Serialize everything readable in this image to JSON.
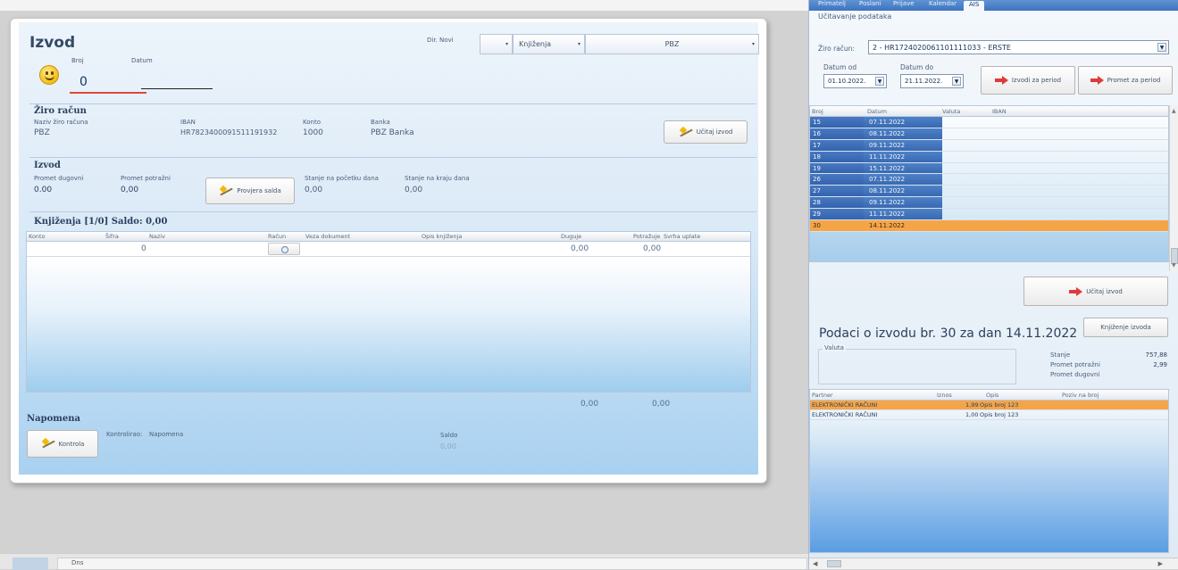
{
  "izvod_form": {
    "title": "Izvod",
    "broj_label": "Broj",
    "broj_value": "0",
    "datum_label": "Datum",
    "dir_label": "Dir. Novi",
    "combo_dir_value": "",
    "combo_type_value": "Knjiženja",
    "combo_bank_value": "PBZ",
    "ziro": {
      "section": "Žiro račun",
      "naziv_label": "Naziv žiro računa",
      "naziv_value": "PBZ",
      "iban_label": "IBAN",
      "iban_value": "HR7823400091511191932",
      "konto_label": "Konto",
      "konto_value": "1000",
      "banka_label": "Banka",
      "banka_value": "PBZ Banka",
      "ucitaj_btn": "Učitaj izvod"
    },
    "izvod": {
      "section": "Izvod",
      "promet_dug_label": "Promet dugovni",
      "promet_dug_value": "0.00",
      "promet_pot_label": "Promet potražni",
      "promet_pot_value": "0,00",
      "provjera_btn": "Provjera salda",
      "stanje_poc_label": "Stanje na početku dana",
      "stanje_poc_value": "0,00",
      "stanje_kraj_label": "Stanje na kraju dana",
      "stanje_kraj_value": "0,00"
    },
    "knjizenja": {
      "section": "Knjiženja  [1/0]  Saldo: 0,00",
      "columns": [
        "Konto",
        "Šifra",
        "Naziv",
        "Račun",
        "Veza dokument",
        "Opis knjiženja",
        "Duguje",
        "Potražuje",
        "Svrha uplate"
      ],
      "row": {
        "sifra": "0",
        "duguje": "0,00",
        "potrazuje": "0,00"
      },
      "total_duguje": "0,00",
      "total_potrazuje": "0,00"
    },
    "napomena": {
      "section": "Napomena",
      "kontrola_btn": "Kontrola",
      "kontrolirao_label": "Kontrolirao:",
      "napomena_label": "Napomena",
      "saldo_label": "Saldo",
      "saldo_value": "0,00"
    }
  },
  "status_bar": {
    "text": "Dns"
  },
  "right_panel": {
    "tabs": [
      "Primatelj",
      "Poslani",
      "Prijave",
      "Kalendar",
      "AIS"
    ],
    "subtitle": "Učitavanje podataka",
    "ziro_label": "Žiro račun:",
    "ziro_value": "2 - HR1724020061101111033 - ERSTE",
    "datum_od_label": "Datum od",
    "datum_od_value": "01.10.2022.",
    "datum_do_label": "Datum do",
    "datum_do_value": "21.11.2022.",
    "btn_izvodi": "Izvodi za period",
    "btn_promet": "Promet za period",
    "list_columns": [
      "Broj",
      "Datum",
      "Valuta",
      "IBAN"
    ],
    "list_rows": [
      {
        "broj": "15",
        "datum": "07.11.2022"
      },
      {
        "broj": "16",
        "datum": "08.11.2022"
      },
      {
        "broj": "17",
        "datum": "09.11.2022"
      },
      {
        "broj": "18",
        "datum": "11.11.2022"
      },
      {
        "broj": "19",
        "datum": "15.11.2022"
      },
      {
        "broj": "26",
        "datum": "07.11.2022"
      },
      {
        "broj": "27",
        "datum": "08.11.2022"
      },
      {
        "broj": "28",
        "datum": "09.11.2022"
      },
      {
        "broj": "29",
        "datum": "11.11.2022"
      },
      {
        "broj": "30",
        "datum": "14.11.2022"
      }
    ],
    "selected_row": 9,
    "btn_ucitaj": "Učitaj izvod",
    "btn_knjizenje": "Knjiženje izvoda",
    "detail_title": "Podaci o izvodu br. 30 za dan 14.11.2022",
    "valuta_label": "Valuta",
    "stanje_label": "Stanje",
    "stanje_value": "757,88",
    "promet_pot_label": "Promet potražni",
    "promet_pot_value": "2,99",
    "promet_dug_label": "Promet dugovni",
    "partner_columns": [
      "Partner",
      "Iznos",
      "Opis",
      "Poziv na broj"
    ],
    "partner_rows": [
      {
        "partner": "ELEKTRONIČKI RAČUNI",
        "iznos": "1,99",
        "opis": "Opis broj 123"
      },
      {
        "partner": "ELEKTRONIČKI RAČUNI",
        "iznos": "1,00",
        "opis": "Opis broj 123"
      }
    ]
  }
}
